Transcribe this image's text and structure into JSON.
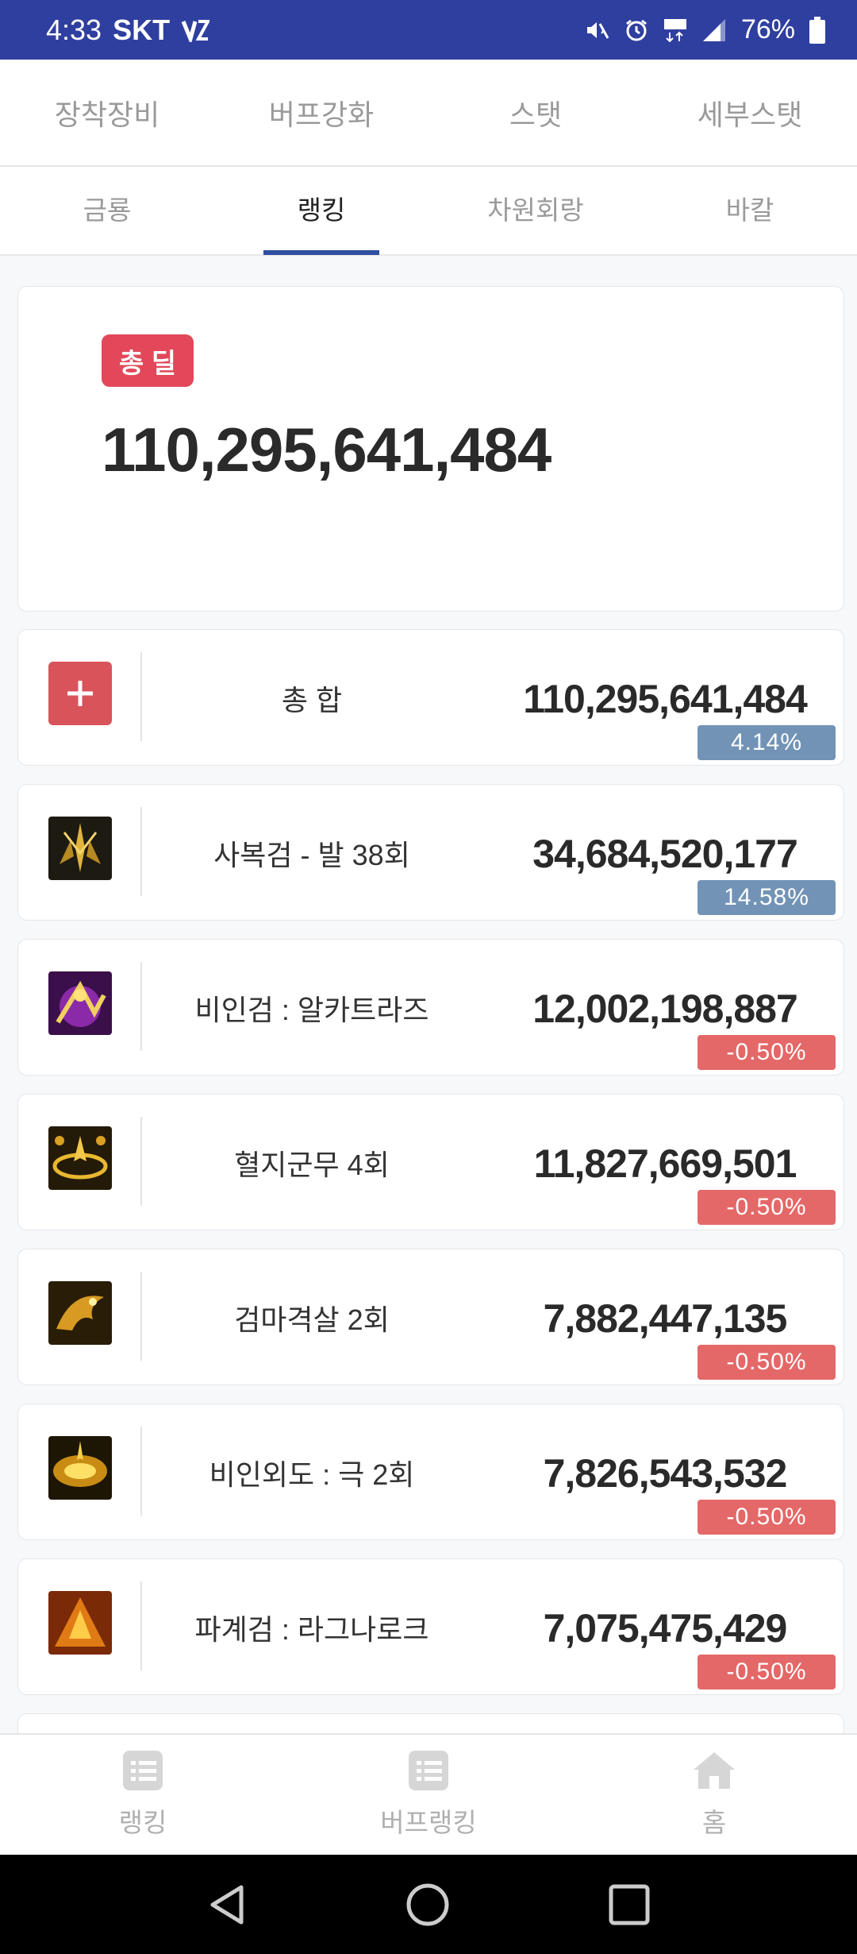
{
  "status_bar": {
    "time": "4:33",
    "carrier": "SKT",
    "battery": "76%"
  },
  "tabs_primary": [
    "장착장비",
    "버프강화",
    "스탯",
    "세부스탯"
  ],
  "tabs_secondary": {
    "items": [
      "금룡",
      "랭킹",
      "차원회랑",
      "바칼"
    ],
    "active": "랭킹"
  },
  "total": {
    "badge": "총 딜",
    "value": "110,295,641,484"
  },
  "rows": [
    {
      "name": "총 합",
      "damage": "110,295,641,484",
      "percent": "4.14%",
      "icon": "plus-icon",
      "trend": "positive"
    },
    {
      "name": "사복검 - 발 38회",
      "damage": "34,684,520,177",
      "percent": "14.58%",
      "icon": "skill-icon-sabokgeom",
      "trend": "positive"
    },
    {
      "name": "비인검 : 알카트라즈",
      "damage": "12,002,198,887",
      "percent": "-0.50%",
      "icon": "skill-icon-alcatraz",
      "trend": "negative"
    },
    {
      "name": "혈지군무 4회",
      "damage": "11,827,669,501",
      "percent": "-0.50%",
      "icon": "skill-icon-hyeoljigunmu",
      "trend": "negative"
    },
    {
      "name": "검마격살 2회",
      "damage": "7,882,447,135",
      "percent": "-0.50%",
      "icon": "skill-icon-geommagyeoksal",
      "trend": "negative"
    },
    {
      "name": "비인외도 : 극 2회",
      "damage": "7,826,543,532",
      "percent": "-0.50%",
      "icon": "skill-icon-biinoedo",
      "trend": "negative"
    },
    {
      "name": "파계검 : 라그나로크",
      "damage": "7,075,475,429",
      "percent": "-0.50%",
      "icon": "skill-icon-ragnarok",
      "trend": "negative"
    }
  ],
  "bottom_nav": [
    {
      "label": "랭킹",
      "icon": "list-icon"
    },
    {
      "label": "버프랭킹",
      "icon": "list-icon"
    },
    {
      "label": "홈",
      "icon": "home-icon"
    }
  ],
  "colors": {
    "status_bar": "#2f3f9f",
    "tab_underline": "#2f4f9f",
    "badge": "#e2485a",
    "positive": "#7293b5",
    "negative": "#e46868"
  }
}
